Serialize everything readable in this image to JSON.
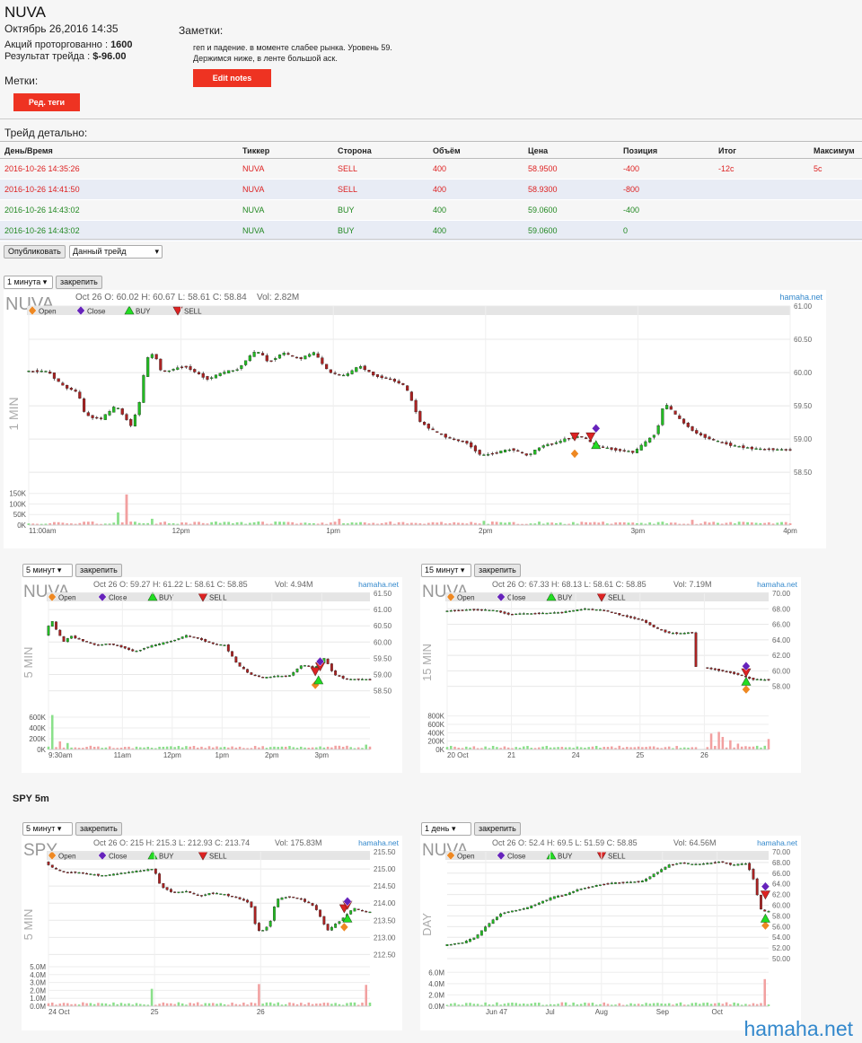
{
  "header": {
    "ticker": "NUVA",
    "datetime": "Октябрь 26,2016 14:35",
    "shares_label": "Акций проторгованно : ",
    "shares_value": "1600",
    "result_label": "Результат трейда : ",
    "result_value": "$-96.00"
  },
  "tags": {
    "label": "Метки:",
    "button": "Ред. теги"
  },
  "notes": {
    "label": "Заметки:",
    "line1": "геп и падение. в моменте слабее рынка. Уровень 59.",
    "line2": "Держимся ниже, в ленте большой аск.",
    "button": "Edit notes"
  },
  "trade_detail": {
    "label": "Трейд детально:",
    "columns": [
      "День/Время",
      "Тиккер",
      "Сторона",
      "Объём",
      "Цена",
      "Позиция",
      "Итог",
      "Максимум"
    ],
    "rows": [
      {
        "cells": [
          "2016-10-26 14:35:26",
          "NUVA",
          "SELL",
          "400",
          "58.9500",
          "-400",
          "-12c",
          "5c"
        ],
        "side": "sell"
      },
      {
        "cells": [
          "2016-10-26 14:41:50",
          "NUVA",
          "SELL",
          "400",
          "58.9300",
          "-800",
          "",
          ""
        ],
        "side": "sell"
      },
      {
        "cells": [
          "2016-10-26 14:43:02",
          "NUVA",
          "BUY",
          "400",
          "59.0600",
          "-400",
          "",
          ""
        ],
        "side": "buy"
      },
      {
        "cells": [
          "2016-10-26 14:43:02",
          "NUVA",
          "BUY",
          "400",
          "59.0600",
          "0",
          "",
          ""
        ],
        "side": "buy"
      }
    ]
  },
  "controls": {
    "publish": "Опубликовать",
    "trade_select": "Данный трейд",
    "pin": "закрепить"
  },
  "section_spy": "SPY 5m",
  "legend": {
    "open": "Open",
    "close": "Close",
    "buy": "BUY",
    "sell": "SELL"
  },
  "colors": {
    "accent": "#ee3322",
    "up": "#22bb22",
    "down": "#aa2222",
    "open": "#ee8822",
    "close": "#6622bb",
    "buy": "#22dd22",
    "sell": "#dd2222",
    "link": "#3388cc"
  },
  "watermark": "hamaha.net",
  "chart_data": [
    {
      "id": "c1",
      "type": "candlestick",
      "symbol": "NUVA",
      "interval_label": "1 минута",
      "side_label": "1 MIN",
      "info": "Oct 26 O: 60.02 H: 60.67 L: 58.61 C: 58.84",
      "vol": "Vol: 2.82M",
      "brand": "hamaha.net",
      "ylim": [
        58.3,
        61.0
      ],
      "yticks": [
        "61.00",
        "60.50",
        "60.00",
        "59.50",
        "59.00",
        "58.50"
      ],
      "ytick_values": [
        61.0,
        60.5,
        60.0,
        59.5,
        59.0,
        58.5
      ],
      "vol_ticks": [
        "150K",
        "100K",
        "50K",
        "0K"
      ],
      "vol_tick_values": [
        150000,
        100000,
        50000,
        0
      ],
      "vol_max": 170000,
      "xticks": [
        "11:00am",
        "12pm",
        "1pm",
        "2pm",
        "3pm",
        "4pm"
      ],
      "xtick_positions": [
        0,
        0.2,
        0.4,
        0.6,
        0.8,
        1.0
      ],
      "series_path": [
        [
          0,
          60.02
        ],
        [
          0.03,
          60.02
        ],
        [
          0.05,
          59.8
        ],
        [
          0.07,
          59.7
        ],
        [
          0.08,
          59.35
        ],
        [
          0.1,
          59.3
        ],
        [
          0.12,
          59.5
        ],
        [
          0.14,
          59.2
        ],
        [
          0.15,
          59.5
        ],
        [
          0.16,
          60.2
        ],
        [
          0.17,
          60.3
        ],
        [
          0.18,
          60.0
        ],
        [
          0.21,
          60.1
        ],
        [
          0.24,
          59.9
        ],
        [
          0.26,
          60.0
        ],
        [
          0.28,
          60.05
        ],
        [
          0.3,
          60.3
        ],
        [
          0.31,
          60.3
        ],
        [
          0.32,
          60.15
        ],
        [
          0.34,
          60.3
        ],
        [
          0.36,
          60.2
        ],
        [
          0.38,
          60.3
        ],
        [
          0.4,
          60.0
        ],
        [
          0.42,
          59.95
        ],
        [
          0.44,
          60.1
        ],
        [
          0.46,
          59.95
        ],
        [
          0.48,
          59.9
        ],
        [
          0.5,
          59.8
        ],
        [
          0.52,
          59.25
        ],
        [
          0.54,
          59.1
        ],
        [
          0.56,
          59.0
        ],
        [
          0.58,
          58.95
        ],
        [
          0.6,
          58.75
        ],
        [
          0.62,
          58.8
        ],
        [
          0.64,
          58.85
        ],
        [
          0.66,
          58.75
        ],
        [
          0.68,
          58.9
        ],
        [
          0.7,
          58.95
        ],
        [
          0.71,
          59.0
        ],
        [
          0.73,
          59.05
        ],
        [
          0.75,
          58.9
        ],
        [
          0.77,
          58.85
        ],
        [
          0.8,
          58.8
        ],
        [
          0.83,
          59.1
        ],
        [
          0.84,
          59.55
        ],
        [
          0.86,
          59.3
        ],
        [
          0.88,
          59.1
        ],
        [
          0.9,
          59.0
        ],
        [
          0.93,
          58.9
        ],
        [
          0.96,
          58.85
        ],
        [
          1.0,
          58.84
        ]
      ],
      "volume_spikes": [
        [
          0.12,
          60000
        ],
        [
          0.13,
          145000
        ],
        [
          0.16,
          30000
        ],
        [
          0.41,
          30000
        ],
        [
          0.6,
          20000
        ],
        [
          0.87,
          25000
        ]
      ],
      "markers": [
        {
          "type": "open",
          "x": 0.717,
          "price": 58.78
        },
        {
          "type": "sell",
          "x": 0.717,
          "price": 59.04
        },
        {
          "type": "sell",
          "x": 0.738,
          "price": 59.04
        },
        {
          "type": "close",
          "x": 0.745,
          "price": 59.16
        },
        {
          "type": "buy",
          "x": 0.745,
          "price": 58.91
        }
      ]
    },
    {
      "id": "c2",
      "type": "candlestick",
      "symbol": "NUVA",
      "interval_label": "5 минут",
      "side_label": "5 MIN",
      "info": "Oct 26 O: 59.27 H: 61.22 L: 58.61 C: 58.85",
      "vol": "Vol: 4.94M",
      "brand": "hamaha.net",
      "ylim": [
        58.35,
        61.5
      ],
      "yticks": [
        "61.50",
        "61.00",
        "60.50",
        "60.00",
        "59.50",
        "59.00",
        "58.50"
      ],
      "ytick_values": [
        61.5,
        61.0,
        60.5,
        60.0,
        59.5,
        59.0,
        58.5
      ],
      "vol_ticks": [
        "600K",
        "400K",
        "200K",
        "0K"
      ],
      "vol_tick_values": [
        600000,
        400000,
        200000,
        0
      ],
      "vol_max": 700000,
      "xticks": [
        "9:30am",
        "11am",
        "12pm",
        "1pm",
        "2pm",
        "3pm"
      ],
      "xtick_positions": [
        0,
        0.23,
        0.385,
        0.54,
        0.695,
        0.85
      ],
      "series_path": [
        [
          0,
          60.2
        ],
        [
          0.02,
          60.7
        ],
        [
          0.04,
          60.3
        ],
        [
          0.06,
          60.0
        ],
        [
          0.08,
          60.2
        ],
        [
          0.1,
          60.1
        ],
        [
          0.13,
          60.0
        ],
        [
          0.16,
          59.9
        ],
        [
          0.2,
          59.95
        ],
        [
          0.24,
          59.85
        ],
        [
          0.28,
          59.7
        ],
        [
          0.32,
          59.85
        ],
        [
          0.36,
          59.95
        ],
        [
          0.4,
          60.05
        ],
        [
          0.44,
          60.2
        ],
        [
          0.48,
          60.1
        ],
        [
          0.52,
          59.95
        ],
        [
          0.56,
          59.9
        ],
        [
          0.6,
          59.3
        ],
        [
          0.64,
          59.0
        ],
        [
          0.68,
          58.9
        ],
        [
          0.72,
          58.95
        ],
        [
          0.76,
          58.95
        ],
        [
          0.8,
          59.3
        ],
        [
          0.84,
          59.2
        ],
        [
          0.87,
          59.5
        ],
        [
          0.9,
          59.0
        ],
        [
          0.94,
          58.85
        ],
        [
          1.0,
          58.85
        ]
      ],
      "volume_spikes": [
        [
          0.01,
          640000
        ],
        [
          0.03,
          150000
        ],
        [
          0.06,
          120000
        ],
        [
          0.99,
          90000
        ]
      ],
      "markers": [
        {
          "type": "open",
          "x": 0.83,
          "price": 58.68
        },
        {
          "type": "buy",
          "x": 0.84,
          "price": 58.82
        },
        {
          "type": "sell",
          "x": 0.83,
          "price": 59.1
        },
        {
          "type": "sell",
          "x": 0.845,
          "price": 59.25
        },
        {
          "type": "close",
          "x": 0.845,
          "price": 59.4
        }
      ]
    },
    {
      "id": "c3",
      "type": "candlestick",
      "symbol": "NUVA",
      "interval_label": "15 минут",
      "side_label": "15 MIN",
      "info": "Oct 26 O: 67.33 H: 68.13 L: 58.61 C: 58.85",
      "vol": "Vol: 7.19M",
      "brand": "hamaha.net",
      "ylim": [
        56.8,
        70.0
      ],
      "yticks": [
        "70.00",
        "68.00",
        "66.00",
        "64.00",
        "62.00",
        "60.00",
        "58.00"
      ],
      "ytick_values": [
        70,
        68,
        66,
        64,
        62,
        60,
        58
      ],
      "vol_ticks": [
        "800K",
        "600K",
        "400K",
        "200K",
        "0K"
      ],
      "vol_tick_values": [
        800000,
        600000,
        400000,
        200000,
        0
      ],
      "vol_max": 900000,
      "xticks": [
        "20 Oct",
        "21",
        "24",
        "25",
        "26"
      ],
      "xtick_positions": [
        0,
        0.2,
        0.4,
        0.6,
        0.8
      ],
      "series_path": [
        [
          0,
          67.7
        ],
        [
          0.08,
          67.9
        ],
        [
          0.16,
          67.8
        ],
        [
          0.2,
          67.3
        ],
        [
          0.28,
          67.4
        ],
        [
          0.36,
          67.5
        ],
        [
          0.44,
          68.0
        ],
        [
          0.5,
          67.8
        ],
        [
          0.56,
          67.1
        ],
        [
          0.62,
          66.5
        ],
        [
          0.66,
          65.5
        ],
        [
          0.7,
          64.9
        ],
        [
          0.74,
          64.8
        ],
        [
          0.78,
          65.0
        ],
        null,
        [
          0.8,
          60.5
        ],
        [
          0.84,
          60.2
        ],
        [
          0.88,
          59.9
        ],
        [
          0.92,
          59.5
        ],
        [
          0.96,
          58.9
        ],
        [
          1.0,
          58.85
        ]
      ],
      "volume_spikes": [
        [
          0.8,
          800000
        ],
        [
          0.82,
          380000
        ],
        [
          0.84,
          420000
        ],
        [
          0.86,
          300000
        ],
        [
          0.88,
          220000
        ],
        [
          0.9,
          140000
        ],
        [
          1.0,
          250000
        ]
      ],
      "markers": [
        {
          "type": "open",
          "x": 0.93,
          "price": 57.6
        },
        {
          "type": "buy",
          "x": 0.93,
          "price": 58.6
        },
        {
          "type": "sell",
          "x": 0.93,
          "price": 59.8
        },
        {
          "type": "close",
          "x": 0.93,
          "price": 60.6
        }
      ]
    },
    {
      "id": "c4",
      "type": "candlestick",
      "symbol": "SPY",
      "interval_label": "5 минут",
      "side_label": "5 MIN",
      "info": "Oct 26 O: 215 H: 215.3 L: 212.93 C: 213.74",
      "vol": "Vol: 175.83M",
      "brand": "hamaha.net",
      "ylim": [
        212.3,
        215.5
      ],
      "yticks": [
        "215.50",
        "215.00",
        "214.50",
        "214.00",
        "213.50",
        "213.00",
        "212.50"
      ],
      "ytick_values": [
        215.5,
        215.0,
        214.5,
        214.0,
        213.5,
        213.0,
        212.5
      ],
      "vol_ticks": [
        "5.0M",
        "4.0M",
        "3.0M",
        "2.0M",
        "1.0M",
        "0.0M"
      ],
      "vol_tick_values": [
        5000000,
        4000000,
        3000000,
        2000000,
        1000000,
        0
      ],
      "vol_max": 5000000,
      "xticks": [
        "24 Oct",
        "25",
        "26"
      ],
      "xtick_positions": [
        0,
        0.33,
        0.66
      ],
      "series_path": [
        [
          0,
          215.2
        ],
        [
          0.03,
          215.0
        ],
        [
          0.06,
          214.9
        ],
        [
          0.1,
          214.9
        ],
        [
          0.14,
          214.85
        ],
        [
          0.18,
          214.8
        ],
        [
          0.22,
          214.85
        ],
        [
          0.26,
          214.9
        ],
        [
          0.3,
          214.95
        ],
        [
          0.34,
          215.0
        ],
        [
          0.36,
          214.5
        ],
        [
          0.4,
          214.3
        ],
        [
          0.44,
          214.35
        ],
        [
          0.48,
          214.2
        ],
        [
          0.52,
          214.3
        ],
        [
          0.56,
          214.25
        ],
        [
          0.6,
          214.15
        ],
        [
          0.64,
          214.0
        ],
        [
          0.66,
          213.2
        ],
        [
          0.68,
          213.2
        ],
        [
          0.7,
          213.4
        ],
        [
          0.72,
          214.1
        ],
        [
          0.76,
          214.2
        ],
        [
          0.8,
          214.1
        ],
        [
          0.84,
          213.9
        ],
        [
          0.88,
          213.2
        ],
        [
          0.92,
          213.5
        ],
        [
          0.96,
          213.85
        ],
        [
          1.0,
          213.74
        ]
      ],
      "volume_spikes": [
        [
          0.32,
          2200000
        ],
        [
          0.66,
          2800000
        ],
        [
          0.99,
          2700000
        ]
      ],
      "markers": [
        {
          "type": "open",
          "x": 0.92,
          "price": 213.3
        },
        {
          "type": "buy",
          "x": 0.93,
          "price": 213.55
        },
        {
          "type": "sell",
          "x": 0.92,
          "price": 213.85
        },
        {
          "type": "sell",
          "x": 0.93,
          "price": 213.95
        },
        {
          "type": "close",
          "x": 0.93,
          "price": 214.05
        }
      ]
    },
    {
      "id": "c5",
      "type": "candlestick",
      "symbol": "NUVA",
      "interval_label": "1 день",
      "side_label": "DAY",
      "info": "Oct 26 O: 52.4 H: 69.5 L: 51.59 C: 58.85",
      "vol": "Vol: 64.56M",
      "brand": "hamaha.net",
      "ylim": [
        49.5,
        70.0
      ],
      "yticks": [
        "70.00",
        "68.00",
        "66.00",
        "64.00",
        "62.00",
        "60.00",
        "58.00",
        "56.00",
        "54.00",
        "52.00",
        "50.00"
      ],
      "ytick_values": [
        70,
        68,
        66,
        64,
        62,
        60,
        58,
        56,
        54,
        52,
        50
      ],
      "vol_ticks": [
        "6.0M",
        "4.0M",
        "2.0M",
        "0.0M"
      ],
      "vol_tick_values": [
        6000000,
        4000000,
        2000000,
        0
      ],
      "vol_max": 7000000,
      "xticks": [
        "Jun 47",
        "Jul",
        "Aug",
        "Sep",
        "Oct"
      ],
      "xtick_positions": [
        0.12,
        0.32,
        0.48,
        0.67,
        0.84
      ],
      "series_path": [
        [
          0,
          52.5
        ],
        [
          0.06,
          53.0
        ],
        [
          0.1,
          54.0
        ],
        [
          0.14,
          56.5
        ],
        [
          0.18,
          58.5
        ],
        [
          0.22,
          59.0
        ],
        [
          0.26,
          59.5
        ],
        [
          0.3,
          60.5
        ],
        [
          0.34,
          61.5
        ],
        [
          0.38,
          62.0
        ],
        [
          0.42,
          63.0
        ],
        [
          0.46,
          63.5
        ],
        [
          0.5,
          64.0
        ],
        [
          0.54,
          64.2
        ],
        [
          0.58,
          64.3
        ],
        [
          0.62,
          64.5
        ],
        [
          0.66,
          66.0
        ],
        [
          0.7,
          67.5
        ],
        [
          0.74,
          68.0
        ],
        [
          0.78,
          67.6
        ],
        [
          0.82,
          67.8
        ],
        [
          0.86,
          68.2
        ],
        [
          0.9,
          67.5
        ],
        [
          0.94,
          67.8
        ],
        [
          0.96,
          66.0
        ],
        [
          0.98,
          61.0
        ],
        [
          0.99,
          58.8
        ]
      ],
      "volume_spikes": [
        [
          0.99,
          4800000
        ],
        [
          0.85,
          600000
        ]
      ],
      "markers": [
        {
          "type": "open",
          "x": 0.99,
          "price": 56.2
        },
        {
          "type": "buy",
          "x": 0.99,
          "price": 57.5
        },
        {
          "type": "sell",
          "x": 0.99,
          "price": 62.0
        },
        {
          "type": "close",
          "x": 0.99,
          "price": 63.5
        }
      ]
    }
  ]
}
